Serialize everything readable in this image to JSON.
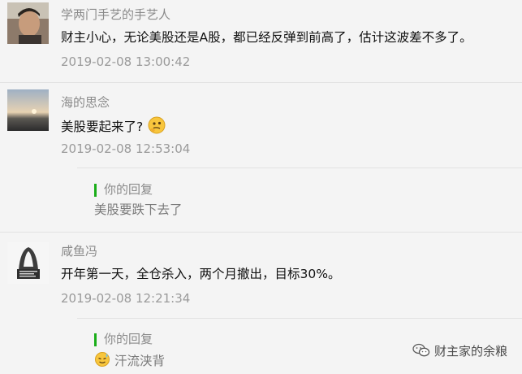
{
  "comments": [
    {
      "name": "学两门手艺的手艺人",
      "content": "财主小心，无论美股还是A股，都已经反弹到前高了，估计这波差不多了。",
      "time": "2019-02-08 13:00:42"
    },
    {
      "name": "海的思念",
      "content": "美股要起来了?",
      "emoji": "thinking-emoji",
      "time": "2019-02-08 12:53:04",
      "reply": {
        "label": "你的回复",
        "text": "美股要跌下去了"
      }
    },
    {
      "name": "咸鱼冯",
      "content": "开年第一天，全仓杀入，两个月撤出，目标30%。",
      "time": "2019-02-08 12:21:34",
      "reply": {
        "label": "你的回复",
        "text": "汗流浃背",
        "emoji": "sweat-emoji"
      }
    }
  ],
  "watermark": {
    "text": "财主家的余粮",
    "icon": "wechat-icon"
  },
  "colors": {
    "accent": "#1aad19",
    "background": "#f4f4f4",
    "meta": "#9a9a9a"
  }
}
